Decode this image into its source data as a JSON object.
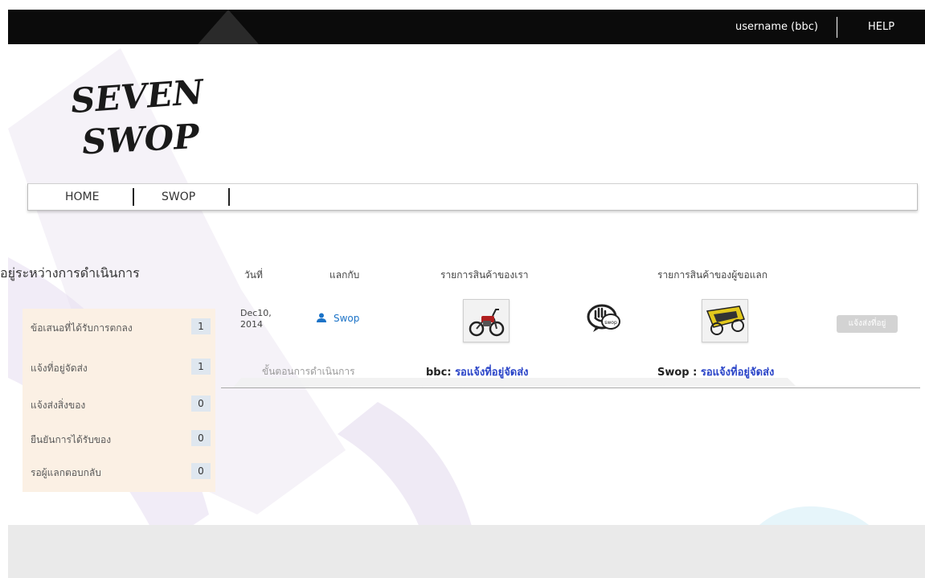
{
  "topbar": {
    "username": "username (bbc)",
    "help": "HELP"
  },
  "logo": {
    "line1": "SEVEN",
    "line2": "SWOP"
  },
  "nav": {
    "items": [
      {
        "label": "HOME"
      },
      {
        "label": "SWOP"
      }
    ]
  },
  "sidebar": {
    "title": "อยู่ระหว่างการดำเนินการ",
    "items": [
      {
        "label": "ข้อเสนอที่ได้รับการตกลง",
        "count": "1"
      },
      {
        "label": "แจ้งที่อยู่จัดส่ง",
        "count": "1"
      },
      {
        "label": "แจ้งส่งสิ่งของ",
        "count": "0"
      },
      {
        "label": "ยืนยันการได้รับของ",
        "count": "0"
      },
      {
        "label": "รอผู้แลกตอบกลับ",
        "count": "0"
      }
    ]
  },
  "table": {
    "headers": {
      "date": "วันที่",
      "exchange_with": "แลกกับ",
      "our_items": "รายการสินค้าของเรา",
      "their_items": "รายการสินค้าของผู้ขอแลก"
    },
    "row": {
      "date_line1": "Dec10,",
      "date_line2": "2014",
      "partner": "Swop",
      "our_item_icon": "motorcycle-image",
      "swap_icon": "swop-hand-icon",
      "swap_icon_text": "swop",
      "their_item_icon": "bicycle-trailer-image",
      "action_button": "แจ้งส่งที่อยู่"
    },
    "progress": {
      "label": "ขั้นตอนการดำเนินการ",
      "bbc_name": "bbc:",
      "bbc_status": "รอแจ้งที่อยู่จัดส่ง",
      "swop_name": "Swop :",
      "swop_status": "รอแจ้งที่อยู่จัดส่ง"
    }
  },
  "colors": {
    "topbar_bg": "#0b0b0b",
    "side_panel_bg": "#fbf0e4",
    "count_badge_bg": "#dfe7ef",
    "status_blue": "#2b45c8",
    "partner_blue": "#1c73c7",
    "footer_bg": "#eaeaea"
  }
}
